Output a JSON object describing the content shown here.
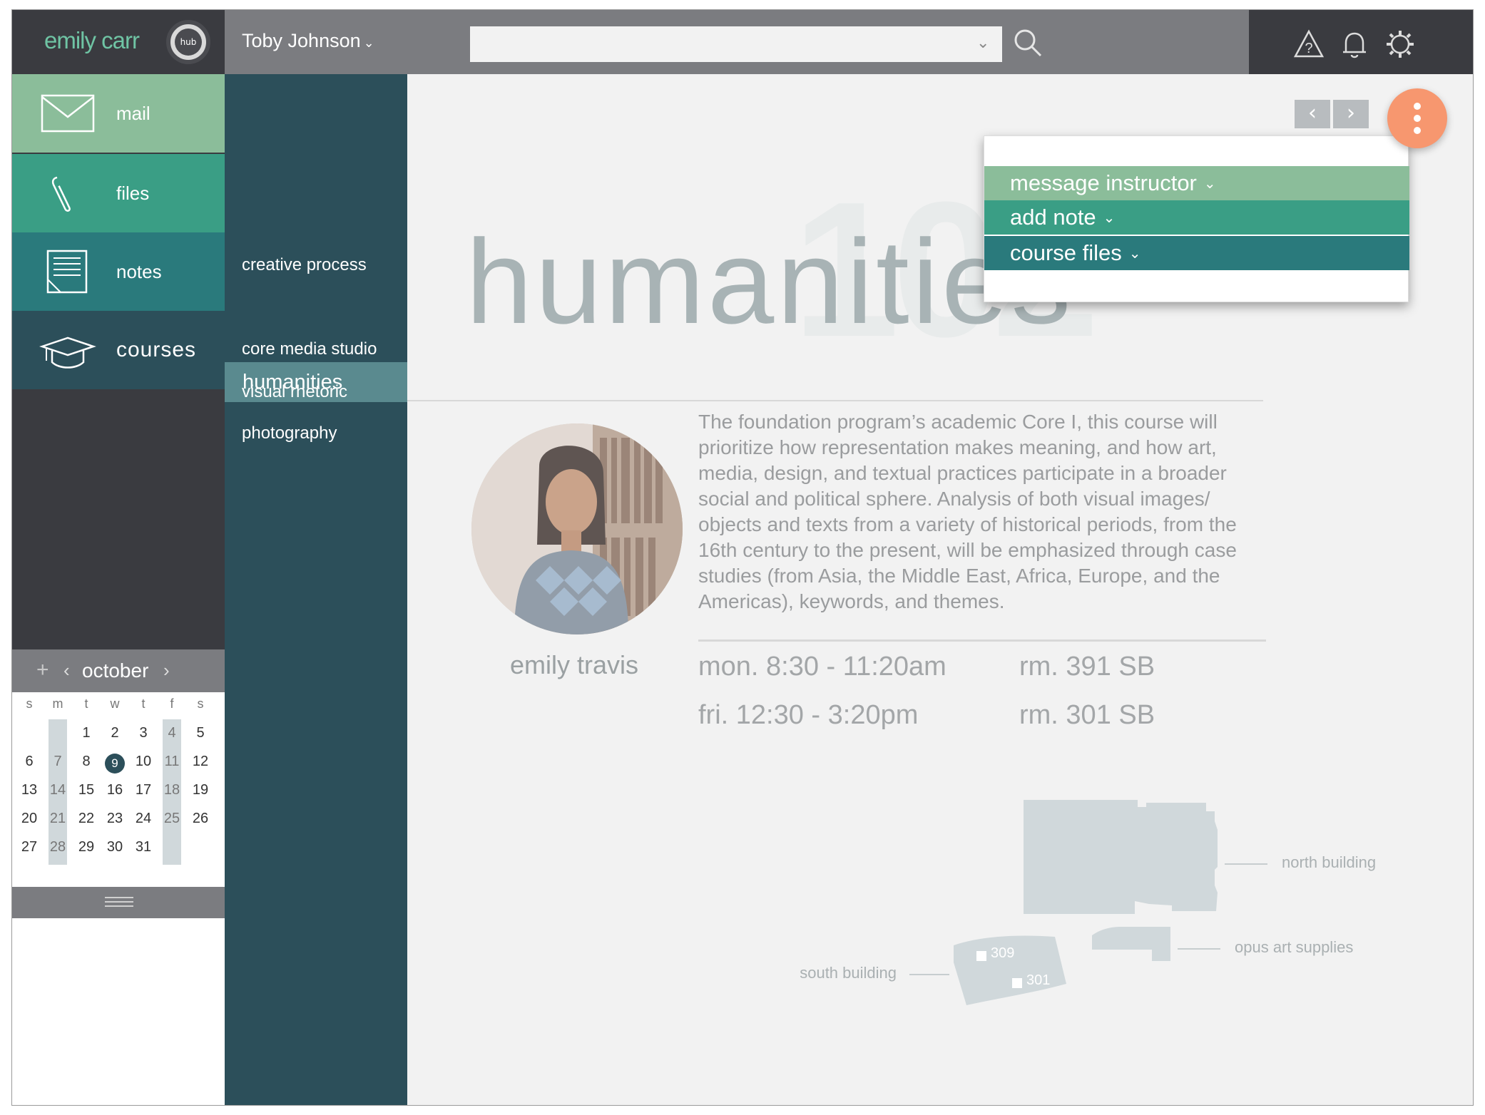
{
  "brand": {
    "name": "emily carr",
    "logo_text": "hub"
  },
  "header": {
    "user": "Toby Johnson",
    "search_placeholder": "",
    "icons": [
      "warning-icon",
      "bell-icon",
      "gear-icon"
    ]
  },
  "nav": [
    {
      "label": "mail",
      "icon": "mail-icon"
    },
    {
      "label": "files",
      "icon": "paperclip-icon"
    },
    {
      "label": "notes",
      "icon": "notes-icon"
    },
    {
      "label": "courses",
      "icon": "graduation-cap-icon"
    }
  ],
  "calendar": {
    "add": "+",
    "prev": "‹",
    "month": "october",
    "next": "›",
    "weekdays": [
      "s",
      "m",
      "t",
      "w",
      "t",
      "f",
      "s"
    ],
    "weeks": [
      [
        "",
        "",
        "1",
        "2",
        "3",
        "4",
        "5"
      ],
      [
        "6",
        "7",
        "8",
        "9",
        "10",
        "11",
        "12"
      ],
      [
        "13",
        "14",
        "15",
        "16",
        "17",
        "18",
        "19"
      ],
      [
        "20",
        "21",
        "22",
        "23",
        "24",
        "25",
        "26"
      ],
      [
        "27",
        "28",
        "29",
        "30",
        "31",
        "",
        ""
      ]
    ],
    "today": "9"
  },
  "courses": [
    {
      "label": "creative process",
      "active": false
    },
    {
      "label": "humanities",
      "active": true
    },
    {
      "label": "core media studio",
      "active": false
    },
    {
      "label": "visual rhetoric",
      "active": false
    },
    {
      "label": "photography",
      "active": false
    }
  ],
  "course": {
    "title": "humanities",
    "number": "102",
    "description": "The foundation program’s academic Core I, this course will prioritize how representation makes meaning, and how art, media, design, and textual practices participate in a broader social and political sphere. Analysis of both visual images/ objects and texts from a variety of historical periods, from the 16th century to the present, will be emphasized through case studies (from Asia, the Middle East, Africa, Europe, and the Americas), keywords, and themes.",
    "instructor": "emily travis",
    "schedule": [
      {
        "time": "mon. 8:30 - 11:20am",
        "room": "rm. 391 SB"
      },
      {
        "time": "fri. 12:30 - 3:20pm",
        "room": "rm. 301 SB"
      }
    ]
  },
  "pager": {
    "prev": "‹",
    "next": "›"
  },
  "menu": {
    "items": [
      {
        "label": "message instructor",
        "color": "#8bbd9a"
      },
      {
        "label": "add note",
        "color": "#3a9e85"
      },
      {
        "label": "course files",
        "color": "#2a7a7c"
      }
    ]
  },
  "map": {
    "north": "north building",
    "opus": "opus art supplies",
    "south": "south building",
    "room_a": "309",
    "room_b": "301"
  },
  "colors": {
    "mail": "#8bbd9a",
    "files": "#3a9e85",
    "notes": "#2a7a7c",
    "courses": "#2c4f5a",
    "accent": "#f7976f"
  }
}
